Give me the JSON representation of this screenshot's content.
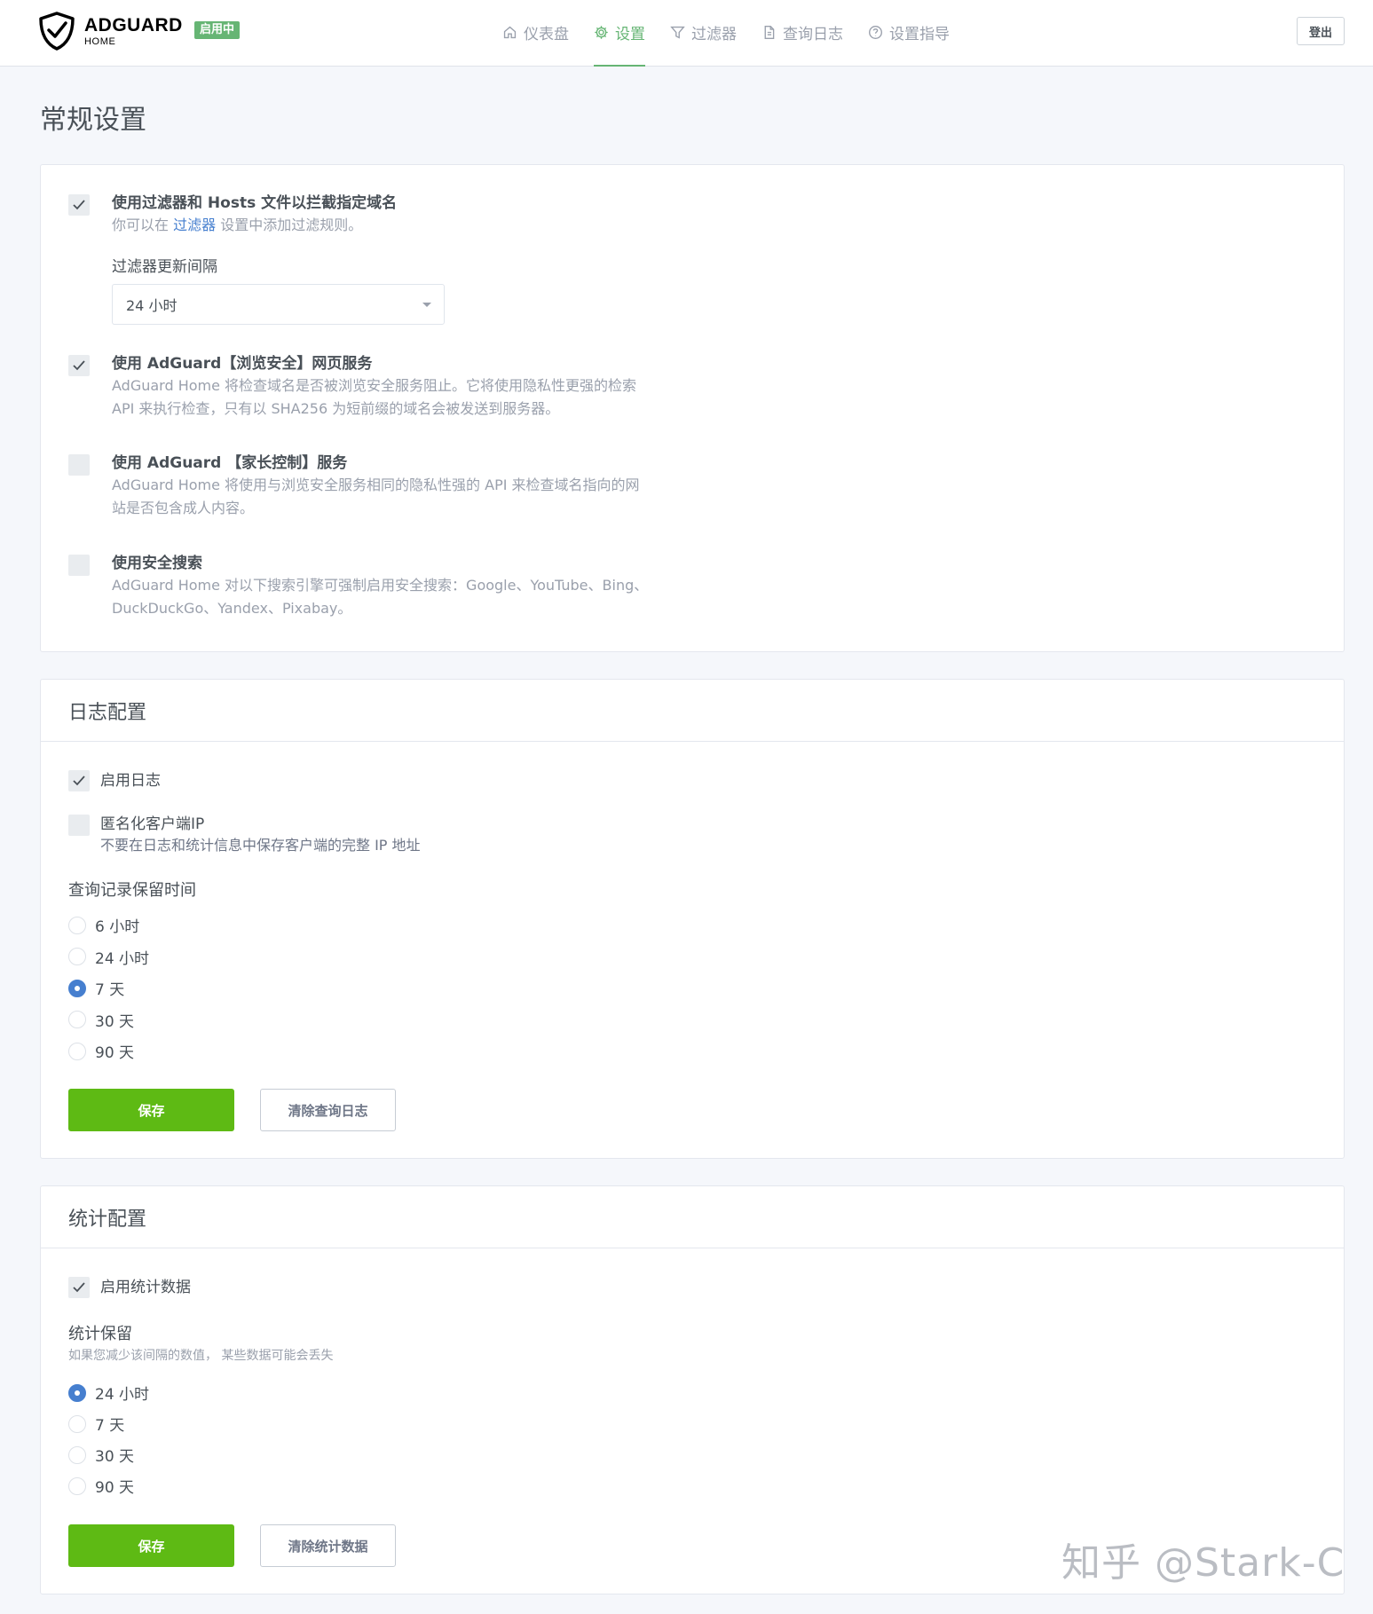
{
  "brand": {
    "name": "ADGUARD",
    "sub": "HOME",
    "status": "启用中"
  },
  "nav": {
    "items": [
      {
        "label": "仪表盘",
        "icon": "home-icon"
      },
      {
        "label": "设置",
        "icon": "gear-icon",
        "active": true
      },
      {
        "label": "过滤器",
        "icon": "filter-icon"
      },
      {
        "label": "查询日志",
        "icon": "document-icon"
      },
      {
        "label": "设置指导",
        "icon": "help-circle-icon"
      }
    ],
    "logout": "登出"
  },
  "page": {
    "title": "常规设置"
  },
  "general": {
    "filters": {
      "checked": true,
      "title": "使用过滤器和 Hosts 文件以拦截指定域名",
      "desc_pre": "你可以在 ",
      "desc_link": "过滤器",
      "desc_post": " 设置中添加过滤规则。",
      "interval_label": "过滤器更新间隔",
      "interval_value": "24 小时"
    },
    "safebrowsing": {
      "checked": true,
      "title": "使用 AdGuard【浏览安全】网页服务",
      "desc_line1": "AdGuard Home 将检查域名是否被浏览安全服务阻止。它将使用隐私性更强的检索",
      "desc_line2": "API 来执行检查，只有以 SHA256 为短前缀的域名会被发送到服务器。"
    },
    "parental": {
      "checked": false,
      "title": "使用 AdGuard 【家长控制】服务",
      "desc_line1": "AdGuard Home 将使用与浏览安全服务相同的隐私性强的 API 来检查域名指向的网",
      "desc_line2": "站是否包含成人内容。"
    },
    "safesearch": {
      "checked": false,
      "title": "使用安全搜索",
      "desc_line1": "AdGuard Home 对以下搜索引擎可强制启用安全搜索：Google、YouTube、Bing、",
      "desc_line2": "DuckDuckGo、Yandex、Pixabay。"
    }
  },
  "log": {
    "header": "日志配置",
    "enable": {
      "checked": true,
      "label": "启用日志"
    },
    "anonymize": {
      "checked": false,
      "label": "匿名化客户端IP",
      "desc": "不要在日志和统计信息中保存客户端的完整 IP 地址"
    },
    "retention_label": "查询记录保留时间",
    "options": [
      "6 小时",
      "24 小时",
      "7 天",
      "30 天",
      "90 天"
    ],
    "selected": "7 天",
    "save": "保存",
    "clear": "清除查询日志"
  },
  "stats": {
    "header": "统计配置",
    "enable": {
      "checked": true,
      "label": "启用统计数据"
    },
    "retention_label": "统计保留",
    "retention_hint": "如果您减少该间隔的数值， 某些数据可能会丢失",
    "options": [
      "24 小时",
      "7 天",
      "30 天",
      "90 天"
    ],
    "selected": "24 小时",
    "save": "保存",
    "clear": "清除统计数据"
  },
  "watermark": "知乎 @Stark-C",
  "colors": {
    "brand_green": "#66b574",
    "primary_button": "#5eba14",
    "link_blue": "#467fcf",
    "radio_blue": "#467fcf"
  }
}
